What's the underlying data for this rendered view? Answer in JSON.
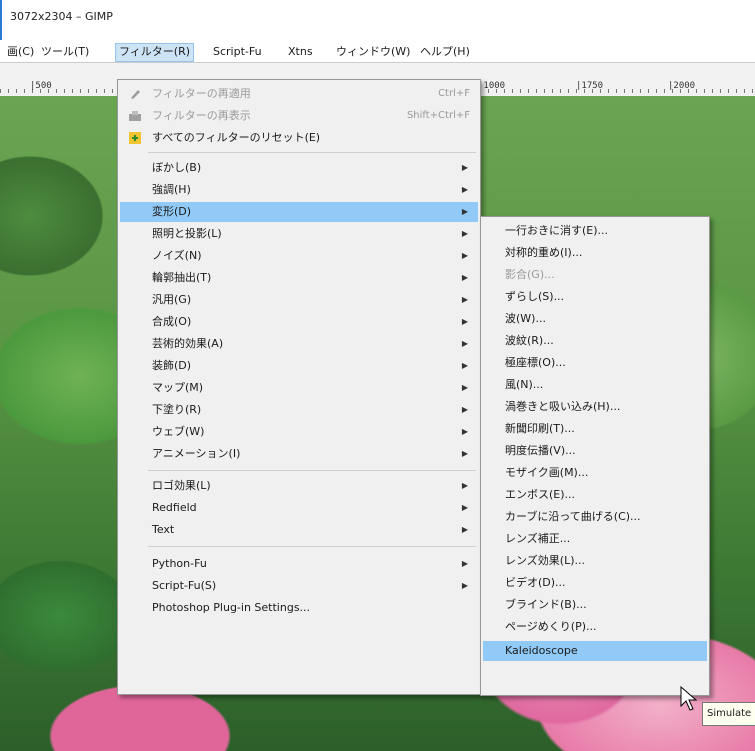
{
  "window": {
    "title": "3072x2304 – GIMP"
  },
  "menubar": [
    "画(C)",
    "ツール(T)",
    "フィルター(R)",
    "Script-Fu",
    "Xtns",
    "ウィンドウ(W)",
    "ヘルプ(H)"
  ],
  "ruler": [
    "|500",
    "|1000",
    "|1750",
    "|2000"
  ],
  "filters_menu": {
    "top": [
      {
        "label": "フィルターの再適用",
        "shortcut": "Ctrl+F",
        "icon": "reapply-icon"
      },
      {
        "label": "フィルターの再表示",
        "shortcut": "Shift+Ctrl+F",
        "icon": "reshow-icon"
      },
      {
        "label": "すべてのフィルターのリセット(E)",
        "icon": "reset-icon"
      }
    ],
    "group1": [
      "ぼかし(B)",
      "強調(H)",
      "変形(D)",
      "照明と投影(L)",
      "ノイズ(N)",
      "輪郭抽出(T)",
      "汎用(G)",
      "合成(O)",
      "芸術的効果(A)",
      "装飾(D)",
      "マップ(M)",
      "下塗り(R)",
      "ウェブ(W)",
      "アニメーション(I)"
    ],
    "group2": [
      "ロゴ効果(L)",
      "Redfield",
      "Text"
    ],
    "group3": [
      "Python-Fu",
      "Script-Fu(S)",
      "Photoshop Plug-in Settings..."
    ]
  },
  "distorts_menu": [
    "一行おきに消す(E)...",
    "対称的重め(I)...",
    "影合(G)...",
    "ずらし(S)...",
    "波(W)...",
    "波紋(R)...",
    "極座標(O)...",
    "風(N)...",
    "渦巻きと吸い込み(H)...",
    "新聞印刷(T)...",
    "明度伝播(V)...",
    "モザイク画(M)...",
    "エンボス(E)...",
    "カーブに沿って曲げる(C)...",
    "レンズ補正...",
    "レンズ効果(L)...",
    "ビデオ(D)...",
    "ブラインド(B)...",
    "ページめくり(P)...",
    "Kaleidoscope"
  ],
  "tooltip": "Simulate"
}
